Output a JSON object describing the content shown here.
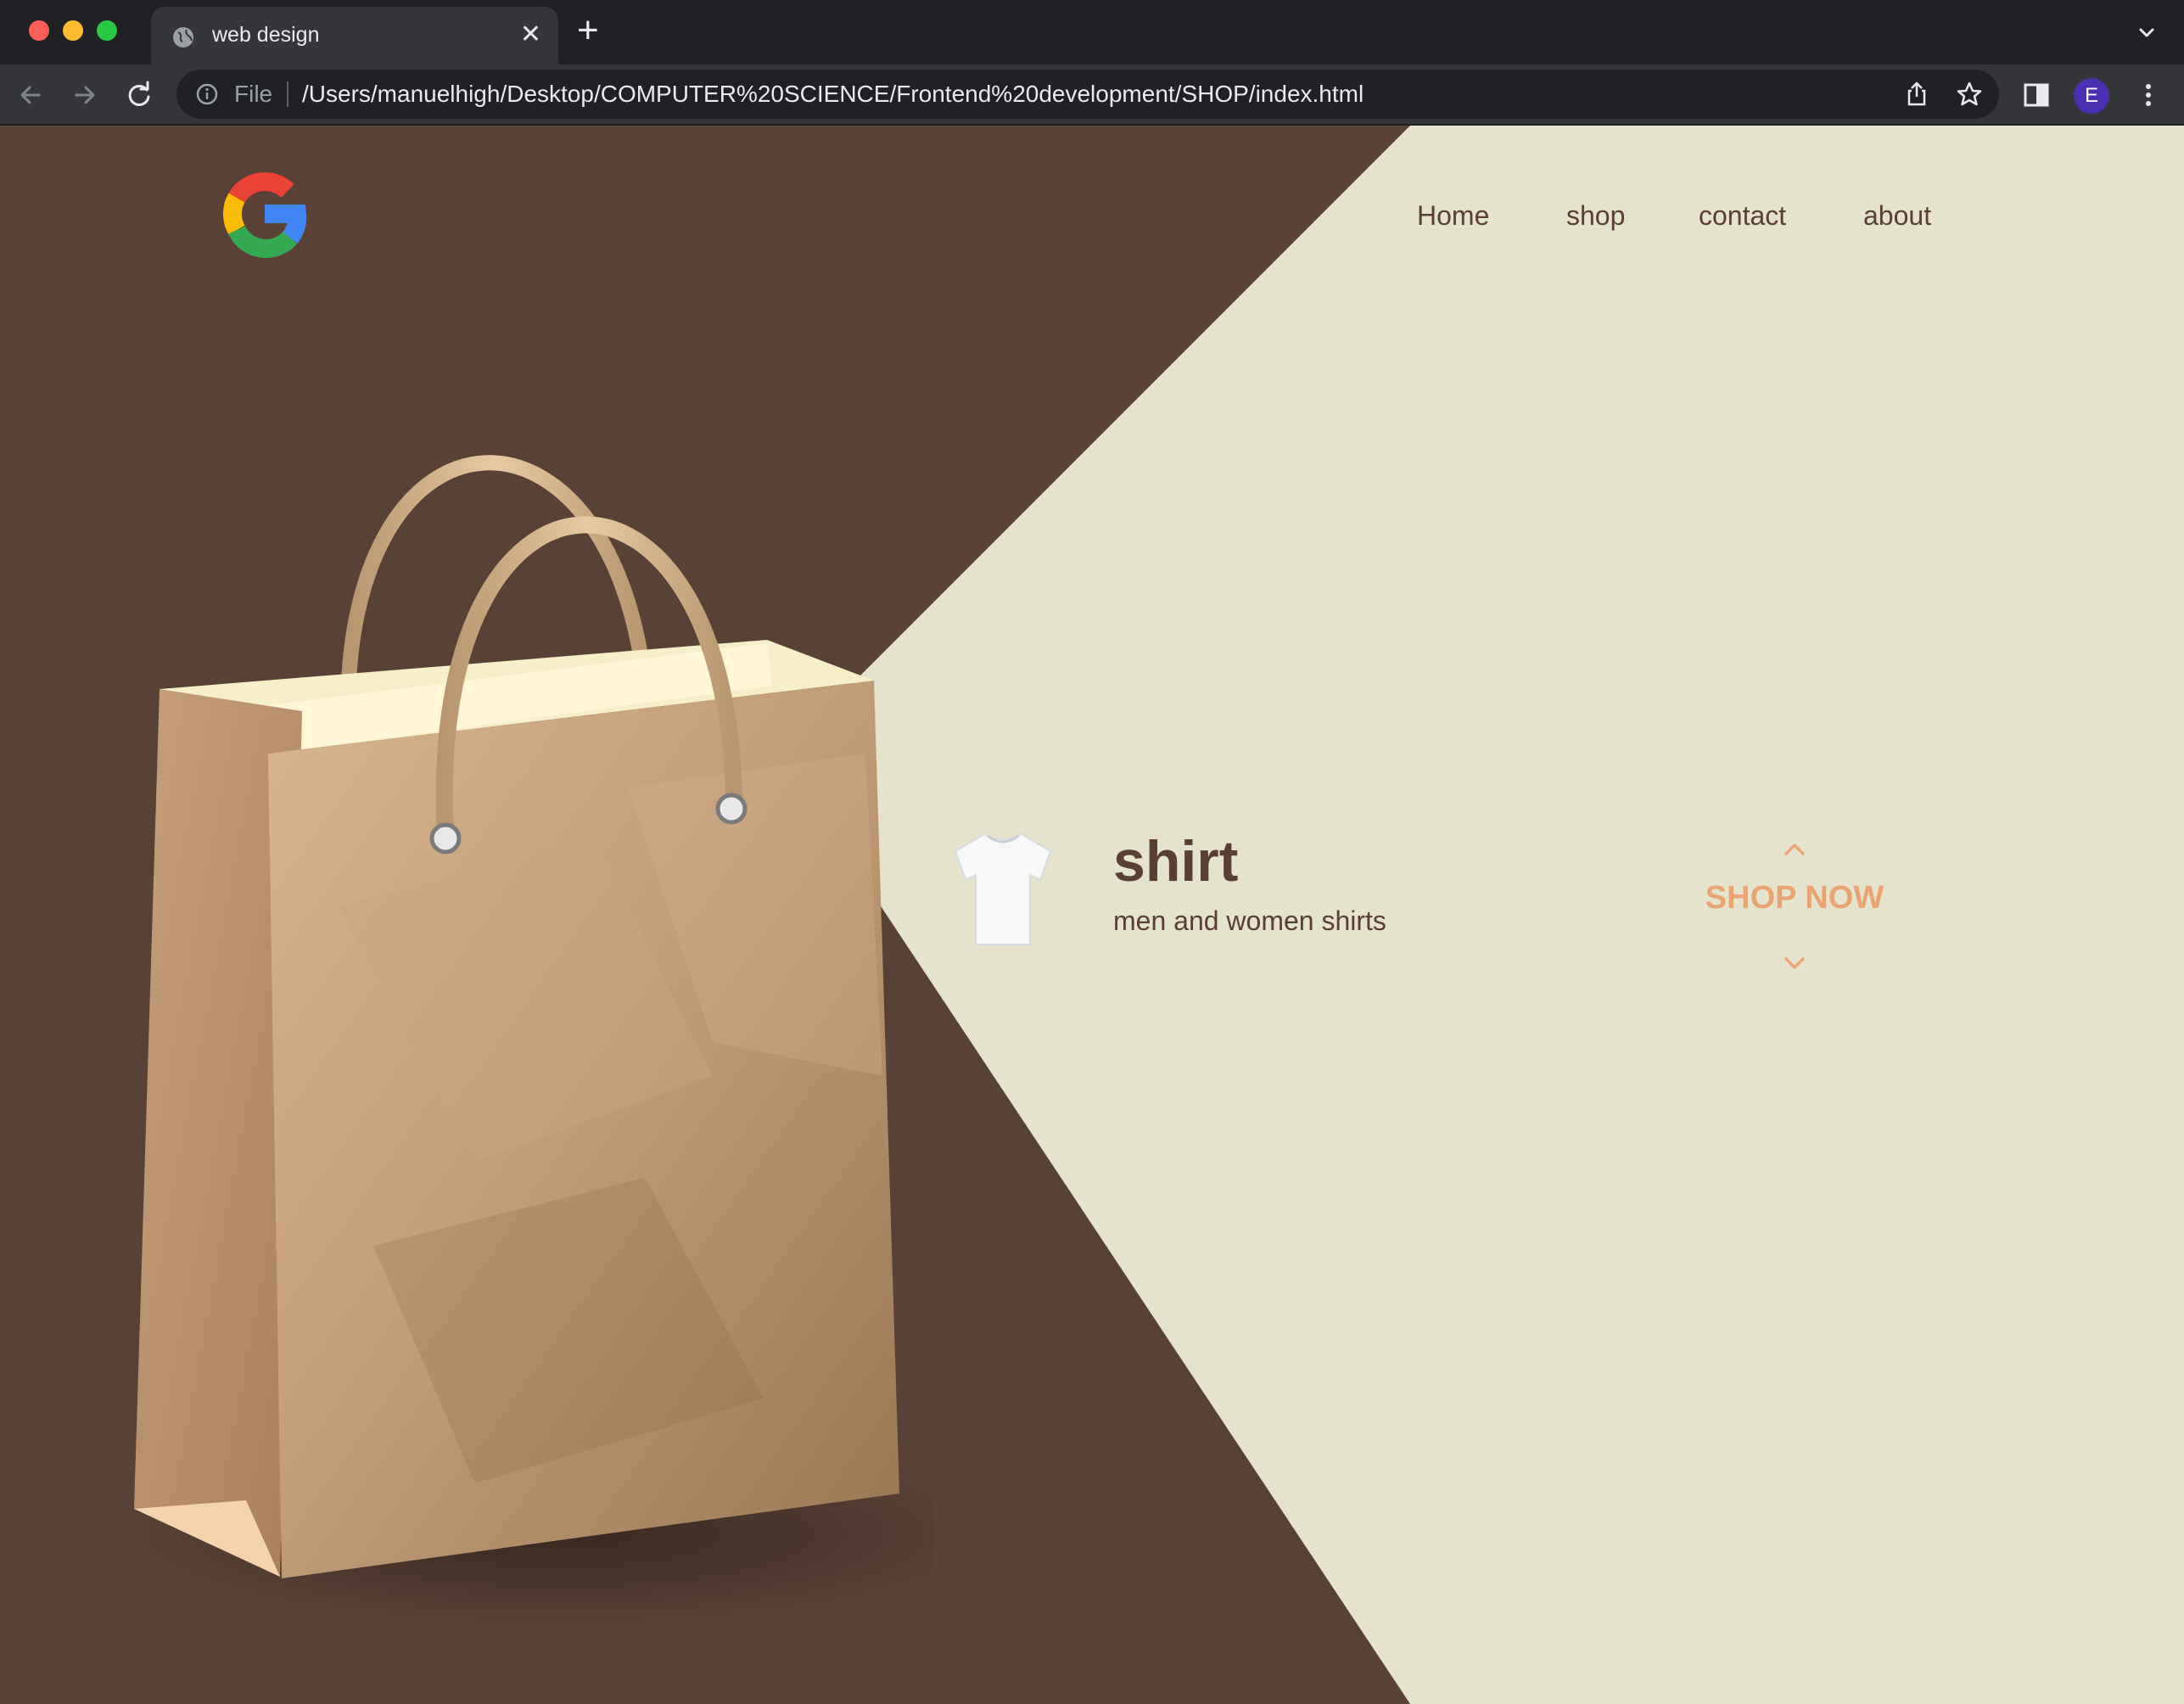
{
  "browser": {
    "tab_title": "web design",
    "tab_close": "✕",
    "new_tab": "+",
    "omnibox_scheme": "File",
    "url": "/Users/manuelhigh/Desktop/COMPUTER%20SCIENCE/Frontend%20development/SHOP/index.html",
    "profile_initial": "E"
  },
  "nav": {
    "home": "Home",
    "shop": "shop",
    "contact": "contact",
    "about": "about"
  },
  "product": {
    "name": "shirt",
    "description": "men and women shirts"
  },
  "cta": {
    "label": "SHOP NOW"
  },
  "colors": {
    "dark_bg": "#5a4135",
    "light_bg": "#e5e3cb",
    "text_brown": "#5a3f32",
    "accent_orange": "#eba470"
  },
  "icons": [
    "globe-icon",
    "search-icon",
    "back-arrow-icon",
    "forward-arrow-icon",
    "reload-icon",
    "info-icon",
    "share-icon",
    "star-icon",
    "side-panel-icon",
    "menu-icon",
    "google-logo-icon",
    "shopping-bag-image",
    "shirt-image",
    "chevron-up-icon",
    "chevron-down-icon"
  ]
}
